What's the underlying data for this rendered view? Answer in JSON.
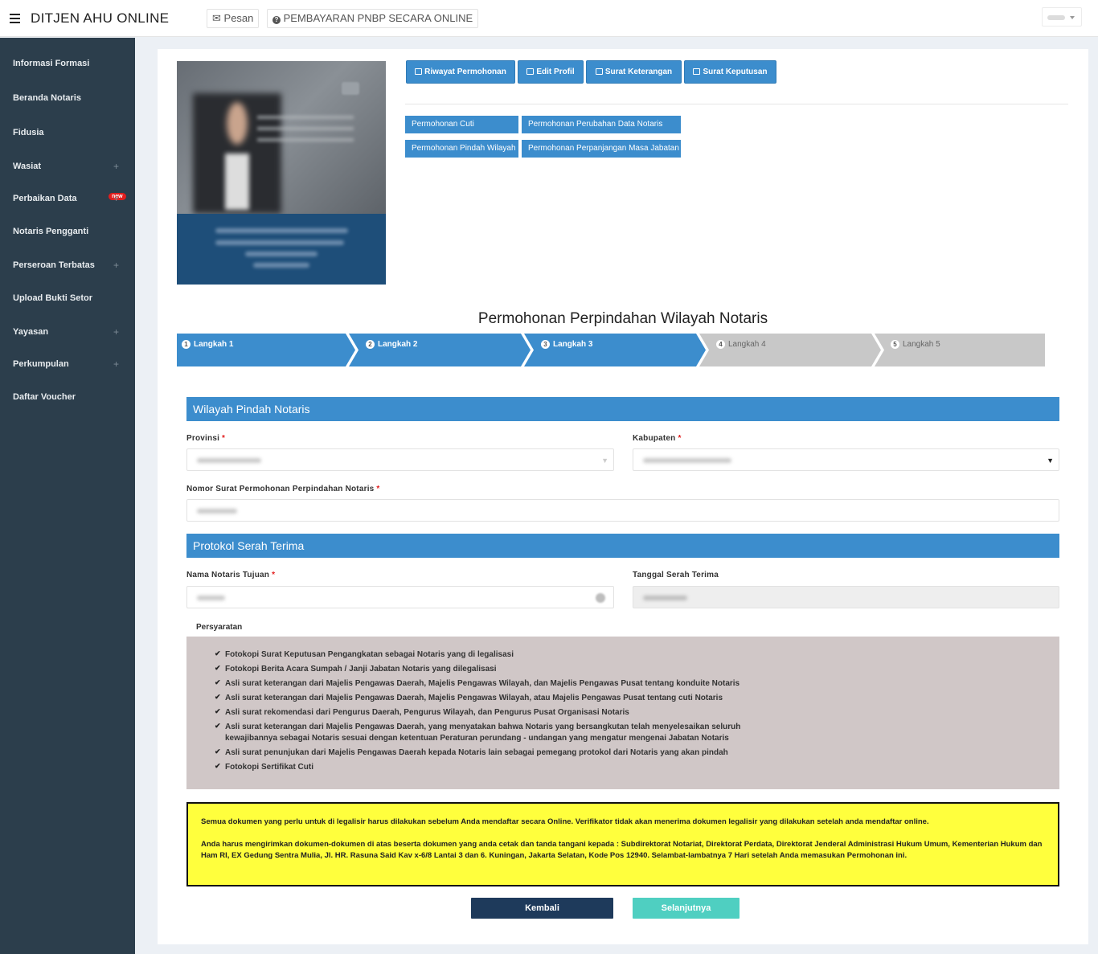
{
  "header": {
    "brand": "DITJEN AHU ONLINE",
    "pesan": "Pesan",
    "pembayaran": "PEMBAYARAN PNBP SECARA ONLINE"
  },
  "sidebar": {
    "items": [
      {
        "label": "Informasi Formasi",
        "expandable": false
      },
      {
        "label": "Beranda Notaris",
        "expandable": false
      },
      {
        "label": "Fidusia",
        "expandable": false
      },
      {
        "label": "Wasiat",
        "expandable": true
      },
      {
        "label": "Perbaikan Data",
        "expandable": true,
        "badge": "new"
      },
      {
        "label": "Notaris Pengganti",
        "expandable": false
      },
      {
        "label": "Perseroan Terbatas",
        "expandable": true
      },
      {
        "label": "Upload Bukti Setor",
        "expandable": false
      },
      {
        "label": "Yayasan",
        "expandable": true
      },
      {
        "label": "Perkumpulan",
        "expandable": true
      },
      {
        "label": "Daftar Voucher",
        "expandable": false
      }
    ],
    "plus": "+"
  },
  "actions": {
    "riwayat": "Riwayat Permohonan",
    "edit_profil": "Edit Profil",
    "surat_keterangan": "Surat Keterangan",
    "surat_keputusan": "Surat Keputusan"
  },
  "requests": {
    "cuti": "Permohonan Cuti",
    "perubahan_data": "Permohonan Perubahan Data Notaris",
    "pindah_wilayah": "Permohonan Pindah Wilayah",
    "perpanjangan": "Permohonan Perpanjangan Masa Jabatan"
  },
  "wizard": {
    "title": "Permohonan Perpindahan Wilayah Notaris",
    "current_step": 3,
    "steps": [
      {
        "num": "1",
        "label": "Langkah 1"
      },
      {
        "num": "2",
        "label": "Langkah 2"
      },
      {
        "num": "3",
        "label": "Langkah 3"
      },
      {
        "num": "4",
        "label": "Langkah 4"
      },
      {
        "num": "5",
        "label": "Langkah 5"
      }
    ]
  },
  "section1": {
    "title": "Wilayah Pindah Notaris",
    "provinsi_label": "Provinsi",
    "kabupaten_label": "Kabupaten",
    "nomor_label": "Nomor Surat Permohonan Perpindahan Notaris",
    "required_mark": "*"
  },
  "section2": {
    "title": "Protokol Serah Terima",
    "nama_label": "Nama Notaris Tujuan",
    "tanggal_label": "Tanggal Serah Terima"
  },
  "persyaratan": {
    "label": "Persyaratan",
    "check_mark": "✔",
    "items": [
      "Fotokopi Surat Keputusan Pengangkatan sebagai Notaris yang di legalisasi",
      "Fotokopi Berita Acara Sumpah / Janji Jabatan Notaris yang dilegalisasi",
      "Asli surat keterangan dari Majelis Pengawas Daerah, Majelis Pengawas Wilayah, dan Majelis Pengawas Pusat tentang konduite Notaris",
      "Asli surat keterangan dari Majelis Pengawas Daerah, Majelis Pengawas Wilayah, atau Majelis Pengawas Pusat tentang cuti Notaris",
      "Asli surat rekomendasi dari Pengurus Daerah, Pengurus Wilayah, dan Pengurus Pusat Organisasi Notaris",
      "Asli surat keterangan dari Majelis Pengawas Daerah, yang menyatakan bahwa Notaris yang bersangkutan telah menyelesaikan seluruh kewajibannya sebagai Notaris sesuai dengan ketentuan Peraturan perundang - undangan yang mengatur mengenai Jabatan Notaris",
      "Asli surat penunjukan dari Majelis Pengawas Daerah kepada Notaris lain sebagai pemegang protokol dari Notaris yang akan pindah",
      "Fotokopi Sertifikat Cuti"
    ]
  },
  "notice": {
    "p1": "Semua dokumen yang perlu untuk di legalisir harus dilakukan sebelum Anda mendaftar secara Online. Verifikator tidak akan menerima dokumen legalisir yang dilakukan setelah anda mendaftar online.",
    "p2": "Anda harus mengirimkan dokumen-dokumen di atas beserta dokumen yang anda cetak dan tanda tangani kepada : Subdirektorat Notariat, Direktorat Perdata, Direktorat Jenderal Administrasi Hukum Umum, Kementerian Hukum dan Ham RI, EX Gedung Sentra Mulia, Jl. HR. Rasuna Said Kav x-6/8 Lantai 3 dan 6. Kuningan, Jakarta Selatan, Kode Pos 12940. Selambat-lambatnya 7 Hari setelah Anda memasukan Permohonan ini."
  },
  "nav": {
    "back": "Kembali",
    "next": "Selanjutnya"
  },
  "colors": {
    "primary": "#3c8dcd",
    "sidebar": "#2c3e4c",
    "step_active": "#3c8dcd",
    "step_inactive": "#c8c8c8",
    "notice_bg": "#ffff3d",
    "back_btn": "#1e3a5b",
    "next_btn": "#4fcfc1"
  }
}
